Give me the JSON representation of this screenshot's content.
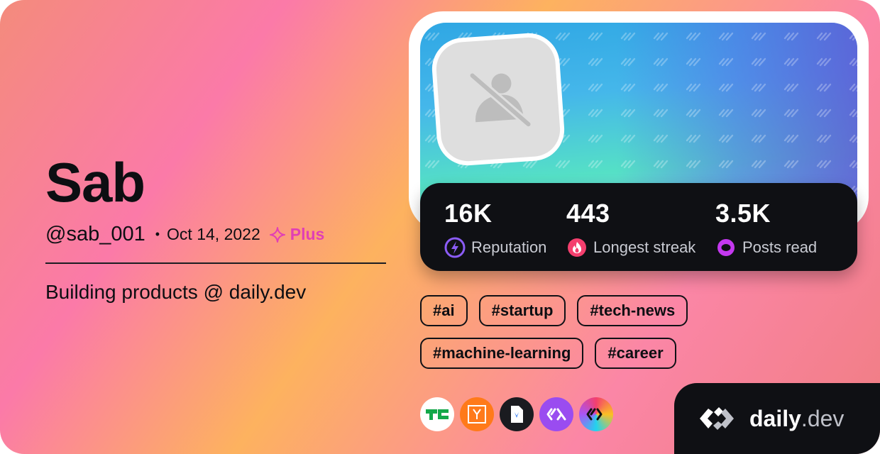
{
  "profile": {
    "name": "Sab",
    "handle": "@sab_001",
    "separator": "•",
    "joined": "Oct 14, 2022",
    "plus_label": "Plus",
    "bio": "Building products @ daily.dev"
  },
  "stats": [
    {
      "value": "16K",
      "label": "Reputation",
      "icon": "lightning-icon"
    },
    {
      "value": "443",
      "label": "Longest streak",
      "icon": "flame-icon"
    },
    {
      "value": "3.5K",
      "label": "Posts read",
      "icon": "eye-ring-icon"
    }
  ],
  "tags": [
    "#ai",
    "#startup",
    "#tech-news",
    "#machine-learning",
    "#career"
  ],
  "sources": [
    "techcrunch-icon",
    "hacker-news-icon",
    "bookmark-doc-icon",
    "daily-dev-icon",
    "community-icon"
  ],
  "brand": {
    "name": "daily",
    "suffix": ".dev"
  },
  "colors": {
    "accent_plus": "#e13fb5",
    "stats_bg": "#0f1014",
    "reputation": "#8b5cf6",
    "streak": "#f43f6e",
    "posts_read": "#c438ef"
  }
}
